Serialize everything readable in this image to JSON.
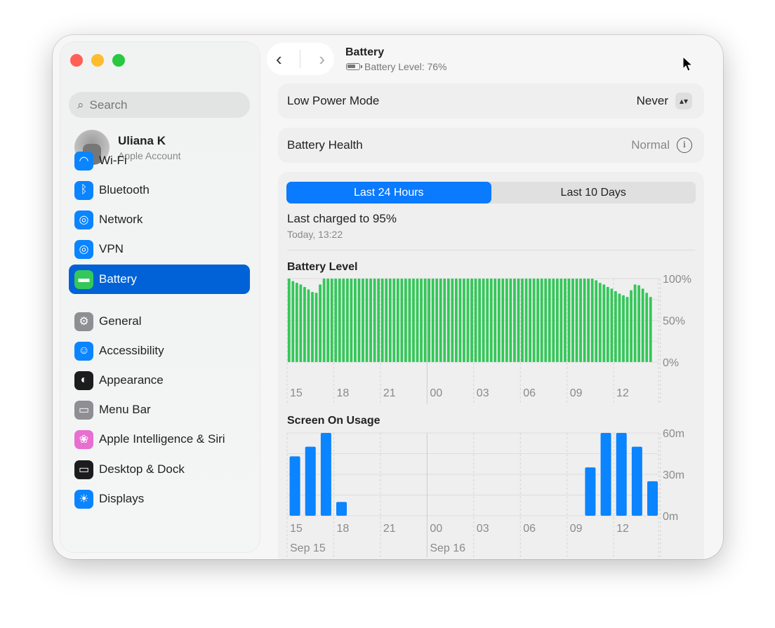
{
  "window": {
    "traffic_lights": [
      "#ff5f57",
      "#febc2e",
      "#28c840"
    ]
  },
  "sidebar": {
    "search_placeholder": "Search",
    "account": {
      "name": "Uliana K",
      "subtitle": "Apple Account"
    },
    "items": [
      {
        "label": "Wi-Fi",
        "icon": "wifi-icon",
        "color": "#0a84ff"
      },
      {
        "label": "Bluetooth",
        "icon": "bluetooth-icon",
        "color": "#0a84ff"
      },
      {
        "label": "Network",
        "icon": "globe-icon",
        "color": "#0a84ff"
      },
      {
        "label": "VPN",
        "icon": "vpn-globe-icon",
        "color": "#0a84ff"
      },
      {
        "label": "Battery",
        "icon": "battery-icon",
        "color": "#34c759",
        "selected": true
      },
      {
        "label": "General",
        "icon": "gear-icon",
        "color": "#8e8e93"
      },
      {
        "label": "Accessibility",
        "icon": "accessibility-icon",
        "color": "#0a84ff"
      },
      {
        "label": "Appearance",
        "icon": "appearance-icon",
        "color": "#1c1c1e"
      },
      {
        "label": "Menu Bar",
        "icon": "menu-bar-icon",
        "color": "#8e8e93"
      },
      {
        "label": "Apple Intelligence & Siri",
        "icon": "siri-icon",
        "color": "#e86fd0"
      },
      {
        "label": "Desktop & Dock",
        "icon": "dock-icon",
        "color": "#1c1c1e"
      },
      {
        "label": "Displays",
        "icon": "sun-icon",
        "color": "#0a84ff"
      }
    ]
  },
  "header": {
    "title": "Battery",
    "subtitle": "Battery Level: 76%"
  },
  "low_power": {
    "label": "Low Power Mode",
    "value": "Never"
  },
  "health": {
    "label": "Battery Health",
    "value": "Normal"
  },
  "tabs": [
    {
      "label": "Last 24 Hours",
      "active": true
    },
    {
      "label": "Last 10 Days",
      "active": false
    }
  ],
  "last_charged": {
    "text": "Last charged to 95%",
    "time": "Today, 13:22"
  },
  "chart_data": [
    {
      "type": "bar",
      "title": "Battery Level",
      "color": "#34c759",
      "ylim": [
        0,
        100
      ],
      "yticks": [
        "100%",
        "50%",
        "0%"
      ],
      "xticks": [
        "15",
        "18",
        "21",
        "00",
        "03",
        "06",
        "09",
        "12"
      ],
      "interval": "15 min",
      "start": "15:00",
      "values": [
        100,
        97,
        95,
        93,
        90,
        87,
        84,
        83,
        93,
        100,
        100,
        100,
        100,
        100,
        100,
        100,
        100,
        100,
        100,
        100,
        100,
        100,
        100,
        100,
        100,
        100,
        100,
        100,
        100,
        100,
        100,
        100,
        100,
        100,
        100,
        100,
        100,
        100,
        100,
        100,
        100,
        100,
        100,
        100,
        100,
        100,
        100,
        100,
        100,
        100,
        100,
        100,
        100,
        100,
        100,
        100,
        100,
        100,
        100,
        100,
        100,
        100,
        100,
        100,
        100,
        100,
        100,
        100,
        100,
        100,
        100,
        100,
        100,
        100,
        100,
        100,
        100,
        100,
        100,
        98,
        95,
        93,
        90,
        88,
        85,
        82,
        80,
        78,
        86,
        93,
        92,
        88,
        83,
        78
      ]
    },
    {
      "type": "bar",
      "title": "Screen On Usage",
      "color": "#0a84ff",
      "ylim": [
        0,
        60
      ],
      "yticks": [
        "60m",
        "30m",
        "0m"
      ],
      "xticks": [
        "15",
        "18",
        "21",
        "00",
        "03",
        "06",
        "09",
        "12"
      ],
      "dates": [
        "Sep 15",
        "Sep 16"
      ],
      "interval": "1 hour",
      "start": "15:00",
      "values": [
        43,
        50,
        60,
        10,
        0,
        0,
        0,
        0,
        0,
        0,
        0,
        0,
        0,
        0,
        0,
        0,
        0,
        0,
        0,
        35,
        60,
        60,
        50,
        25
      ]
    }
  ]
}
